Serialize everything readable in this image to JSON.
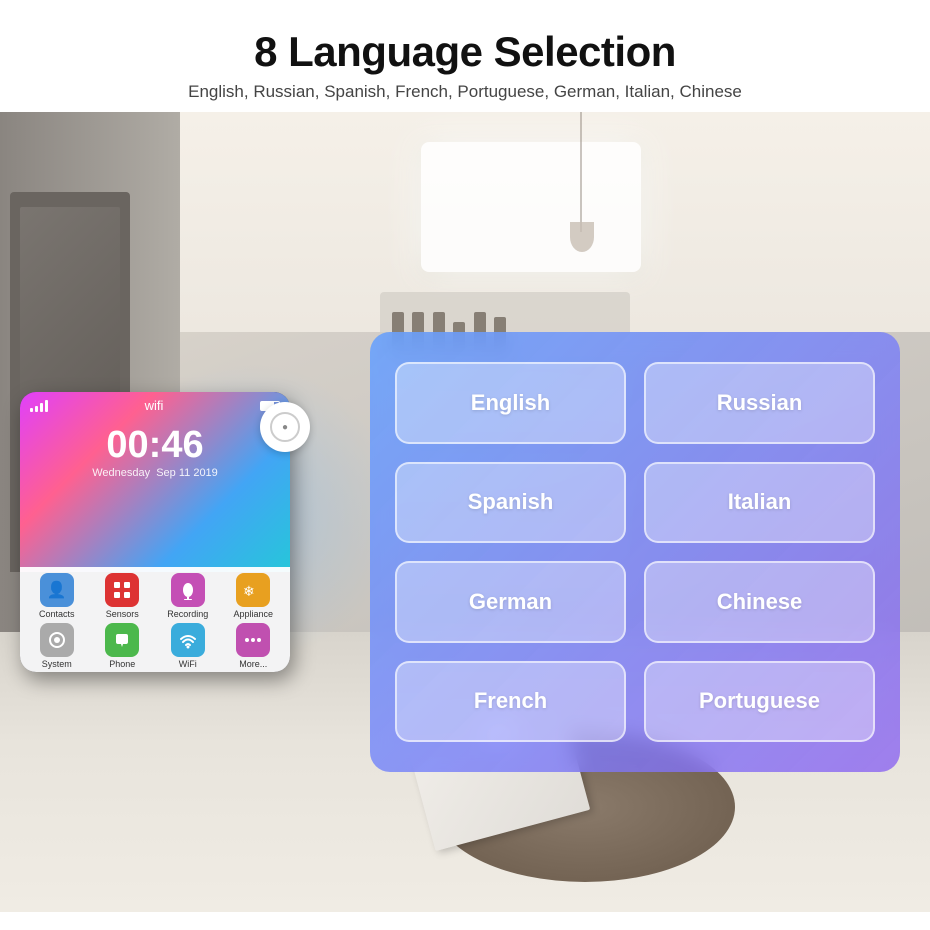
{
  "header": {
    "title": "8 Language Selection",
    "subtitle": "English, Russian, Spanish, French, Portuguese, German, Italian, Chinese"
  },
  "device": {
    "time": "00:46",
    "date_line1": "Wednesday",
    "date_line2": "Sep 11 2019",
    "apps": [
      {
        "label": "Contacts",
        "color": "#4a90d9",
        "icon": "👤"
      },
      {
        "label": "Sensors",
        "color": "#e55",
        "icon": "⊞"
      },
      {
        "label": "Recording",
        "color": "#c44fb5",
        "icon": "🎙"
      },
      {
        "label": "Appliance",
        "color": "#e8a020",
        "icon": "❄"
      },
      {
        "label": "System",
        "color": "#aaa",
        "icon": "⚙"
      },
      {
        "label": "Phone",
        "color": "#4cb84c",
        "icon": "📞"
      },
      {
        "label": "WiFi",
        "color": "#3aacdc",
        "icon": "📶"
      },
      {
        "label": "More...",
        "color": "#c050b0",
        "icon": "···"
      }
    ]
  },
  "languages": [
    {
      "id": "english",
      "label": "English"
    },
    {
      "id": "russian",
      "label": "Russian"
    },
    {
      "id": "spanish",
      "label": "Spanish"
    },
    {
      "id": "italian",
      "label": "Italian"
    },
    {
      "id": "german",
      "label": "German"
    },
    {
      "id": "chinese",
      "label": "Chinese"
    },
    {
      "id": "french",
      "label": "French"
    },
    {
      "id": "portuguese",
      "label": "Portuguese"
    }
  ]
}
